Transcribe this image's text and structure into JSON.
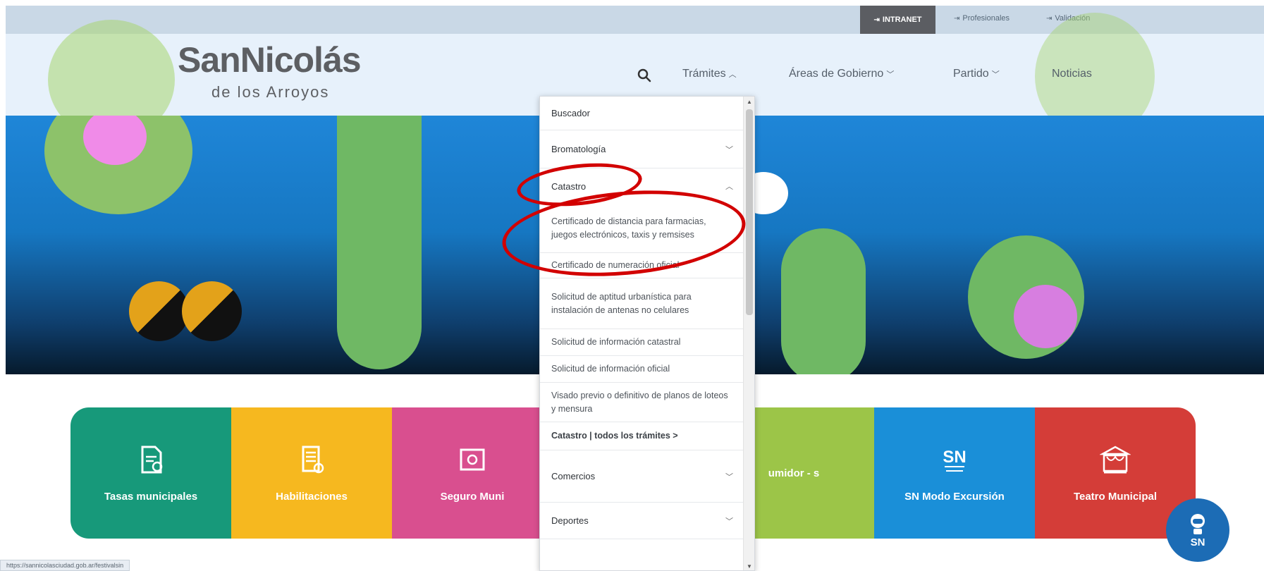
{
  "topbar": {
    "intranet": "INTRANET",
    "profesionales": "Profesionales",
    "validacion": "Validación"
  },
  "header": {
    "logo_main": "SanNicolás",
    "logo_sub": "de los Arroyos",
    "nav": [
      {
        "label": "Trámites",
        "chevron": "^"
      },
      {
        "label": "Áreas de Gobierno",
        "chevron": "v"
      },
      {
        "label": "Partido",
        "chevron": "v"
      },
      {
        "label": "Noticias"
      }
    ]
  },
  "dropdown": {
    "items": [
      {
        "label": "Buscador"
      },
      {
        "label": "Bromatología",
        "chevron": "v"
      },
      {
        "label": "Catastro",
        "chevron": "^"
      },
      {
        "label": "Certificado de distancia para farmacias, juegos electrónicos, taxis y remsises",
        "sub": true
      },
      {
        "label": "Certificado de numeración oficial",
        "sub": true
      },
      {
        "label": "Solicitud de aptitud urbanística para instalación de antenas no celulares",
        "sub": true
      },
      {
        "label": "Solicitud de información catastral",
        "sub": true
      },
      {
        "label": "Solicitud de información oficial",
        "sub": true
      },
      {
        "label": "Visado previo o definitivo de planos de loteos y mensura",
        "sub": true
      },
      {
        "label": "Catastro | todos los trámites >",
        "sub": true
      },
      {
        "label": "Comercios",
        "chevron": "v"
      },
      {
        "label": "Deportes",
        "chevron": "v"
      }
    ]
  },
  "tiles": [
    {
      "label": "Tasas municipales",
      "color": "#17997a",
      "icon": "document-icon"
    },
    {
      "label": "Habilitaciones",
      "color": "#f6b81f",
      "icon": "checklist-icon"
    },
    {
      "label": "Seguro Muni",
      "color": "#d94f8f",
      "icon": "shield-icon"
    },
    {
      "label": "umidor - s",
      "color": "#9cc548",
      "icon": "none"
    },
    {
      "label": "SN Modo Excursión",
      "color": "#1a8fd8",
      "icon": "sn-excursion-icon"
    },
    {
      "label": "Teatro Municipal",
      "color": "#d43d38",
      "icon": "theater-icon"
    }
  ],
  "chat": {
    "label": "SN"
  },
  "status_url": "https://sannicolasciudad.gob.ar/festivalsin"
}
